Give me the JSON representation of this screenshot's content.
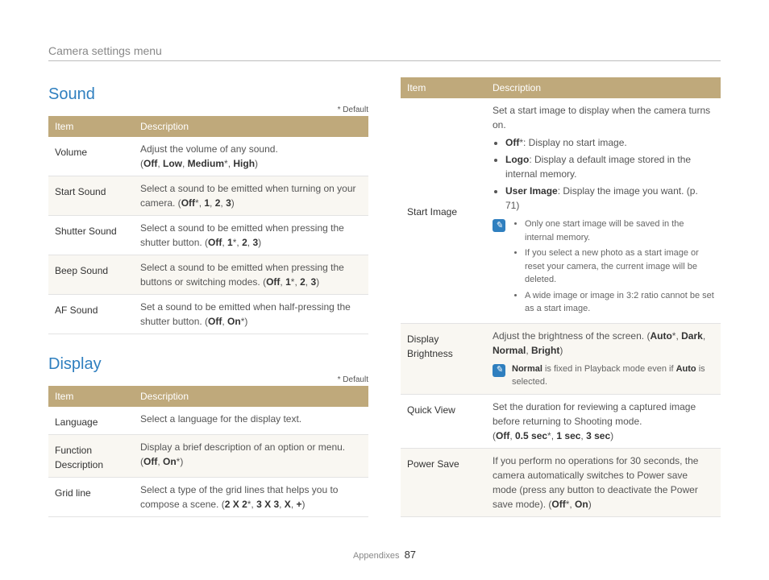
{
  "header": {
    "title": "Camera settings menu"
  },
  "default_label": "* Default",
  "sections": {
    "sound": {
      "title": "Sound",
      "header_item": "Item",
      "header_desc": "Description",
      "rows": {
        "volume": {
          "label": "Volume",
          "desc_pre": "Adjust the volume of any sound.",
          "opts_open": "(",
          "o1": "Off",
          "c1": ", ",
          "o2": "Low",
          "c2": ", ",
          "o3": "Medium",
          "star3": "*",
          "c3": ", ",
          "o4": "High",
          "opts_close": ")"
        },
        "start_sound": {
          "label": "Start Sound",
          "desc": "Select a sound to be emitted when turning on your camera. (",
          "o1": "Off",
          "star1": "*",
          "c1": ", ",
          "o2": "1",
          "c2": ", ",
          "o3": "2",
          "c3": ", ",
          "o4": "3",
          "close": ")"
        },
        "shutter_sound": {
          "label": "Shutter Sound",
          "desc": "Select a sound to be emitted when pressing the shutter button. (",
          "o1": "Off",
          "c1": ", ",
          "o2": "1",
          "star2": "*",
          "c2": ", ",
          "o3": "2",
          "c3": ", ",
          "o4": "3",
          "close": ")"
        },
        "beep_sound": {
          "label": "Beep Sound",
          "desc": "Select a sound to be emitted when pressing the buttons or switching modes. (",
          "o1": "Off",
          "c1": ", ",
          "o2": "1",
          "star2": "*",
          "c2": ", ",
          "o3": "2",
          "c3": ", ",
          "o4": "3",
          "close": ")"
        },
        "af_sound": {
          "label": "AF Sound",
          "desc": "Set a sound to be emitted when half-pressing the shutter button. (",
          "o1": "Off",
          "c1": ", ",
          "o2": "On",
          "star2": "*",
          "close": ")"
        }
      }
    },
    "display": {
      "title": "Display",
      "header_item": "Item",
      "header_desc": "Description",
      "rows": {
        "language": {
          "label": "Language",
          "desc": "Select a language for the display text."
        },
        "function_desc": {
          "label": "Function Description",
          "desc": "Display a brief description of an option or menu. (",
          "o1": "Off",
          "c1": ", ",
          "o2": "On",
          "star2": "*",
          "close": ")"
        },
        "grid_line": {
          "label": "Grid line",
          "desc": "Select a type of the grid lines that helps you to compose a scene. (",
          "o1": "2 X 2",
          "star1": "*",
          "c1": ", ",
          "o2": "3 X 3",
          "c2": ", ",
          "o3": "X",
          "c3": ", ",
          "o4": "+",
          "close": ")"
        }
      }
    },
    "display2": {
      "header_item": "Item",
      "header_desc": "Description",
      "rows": {
        "start_image": {
          "label": "Start Image",
          "intro": "Set a start image to display when the camera turns on.",
          "b1_label": "Off",
          "b1_star": "*",
          "b1_text": ": Display no start image.",
          "b2_label": "Logo",
          "b2_text": ": Display a default image stored in the internal memory.",
          "b3_label": "User Image",
          "b3_text": ": Display the image you want. (p. 71)",
          "notes": {
            "n1": "Only one start image will be saved in the internal memory.",
            "n2": "If you select a new photo as a start image or reset your camera, the current image will be deleted.",
            "n3": "A wide image or image in 3:2 ratio cannot be set as a start image."
          }
        },
        "display_brightness": {
          "label": "Display Brightness",
          "desc": "Adjust the brightness of the screen. (",
          "o1": "Auto",
          "star1": "*",
          "c1": ", ",
          "o2": "Dark",
          "c2": ", ",
          "o3": "Normal",
          "c3": ", ",
          "o4": "Bright",
          "close": ")",
          "note_pre": "Normal",
          "note_mid": " is fixed in Playback mode even if ",
          "note_b": "Auto",
          "note_post": " is selected."
        },
        "quick_view": {
          "label": "Quick View",
          "desc": "Set the duration for reviewing a captured image before returning to Shooting mode.",
          "opts_open": "(",
          "o1": "Off",
          "c1": ", ",
          "o2": "0.5 sec",
          "star2": "*",
          "c2": ", ",
          "o3": "1 sec",
          "c3": ", ",
          "o4": "3 sec",
          "close": ")"
        },
        "power_save": {
          "label": "Power Save",
          "desc": "If you perform no operations for 30 seconds, the camera automatically switches to Power save mode (press any button to deactivate the Power save mode). (",
          "o1": "Off",
          "star1": "*",
          "c1": ", ",
          "o2": "On",
          "close": ")"
        }
      }
    }
  },
  "footer": {
    "section": "Appendixes",
    "page": "87"
  }
}
